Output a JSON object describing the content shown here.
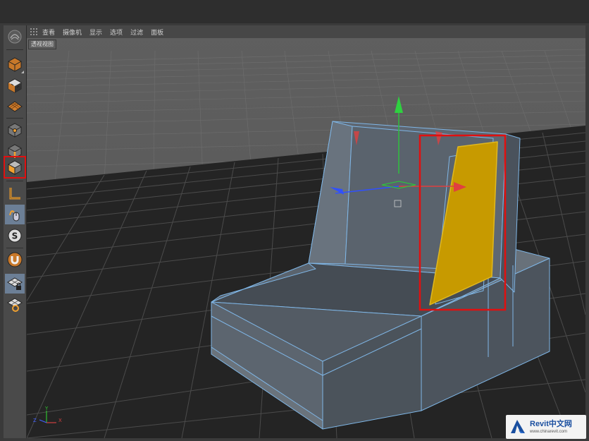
{
  "menu": {
    "items": [
      {
        "label": "查看"
      },
      {
        "label": "摄像机"
      },
      {
        "label": "显示"
      },
      {
        "label": "选项"
      },
      {
        "label": "过滤"
      },
      {
        "label": "面板"
      }
    ]
  },
  "viewport": {
    "label": "透视视图",
    "axes": {
      "x": "X",
      "y": "Y",
      "z": "Z"
    }
  },
  "toolbar": {
    "tools": [
      {
        "name": "model-mode-icon"
      },
      {
        "name": "texture-mode-icon"
      },
      {
        "name": "workplane-mode-icon"
      },
      {
        "name": "points-mode-icon"
      },
      {
        "name": "edges-mode-icon"
      },
      {
        "name": "polygons-mode-icon",
        "selected": true
      },
      {
        "name": "axis-mode-icon"
      },
      {
        "name": "tweak-mode-icon"
      },
      {
        "name": "snap-icon"
      },
      {
        "name": "magnet-icon"
      },
      {
        "name": "workplane-lock-icon"
      },
      {
        "name": "workplane-rotate-icon"
      }
    ]
  },
  "colors": {
    "highlight": "#e01010",
    "selected_polygon": "#c79a00",
    "wireframe": "#7fb6e6",
    "model": "#5c6570"
  },
  "watermark": {
    "title": "Revit中文网",
    "url": "www.chinarevit.com"
  }
}
